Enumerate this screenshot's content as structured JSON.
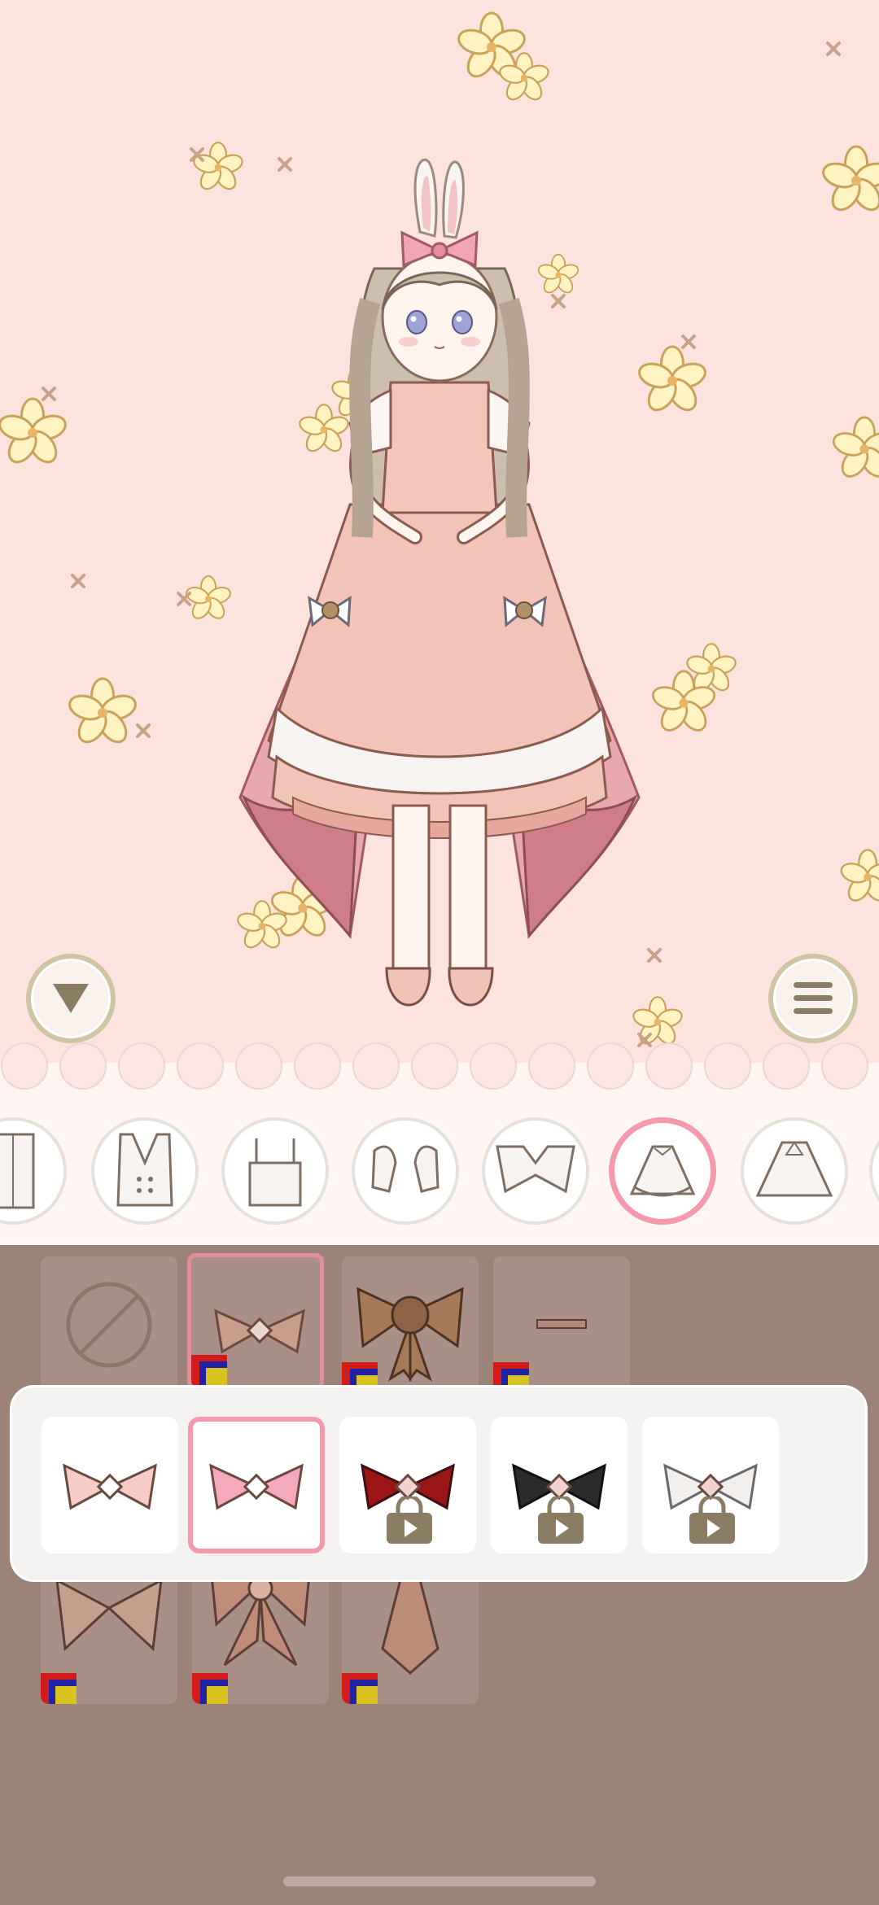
{
  "app": {
    "screen": "dress-up-editor",
    "accent_color": "#f49aac",
    "background_color": "#fde3de",
    "panel_color": "#9c8378"
  },
  "controls": {
    "collapse_icon": "triangle-down-icon",
    "menu_icon": "hamburger-menu-icon"
  },
  "categories": [
    {
      "name": "back-top",
      "icon": "shirt-back-icon",
      "selected": false
    },
    {
      "name": "corset-vest",
      "icon": "vest-icon",
      "selected": false
    },
    {
      "name": "camisole",
      "icon": "camisole-icon",
      "selected": false
    },
    {
      "name": "sleeves",
      "icon": "sleeves-icon",
      "selected": false
    },
    {
      "name": "collar",
      "icon": "collar-icon",
      "selected": false
    },
    {
      "name": "skirt",
      "icon": "skirt-icon",
      "selected": true
    },
    {
      "name": "cape",
      "icon": "cape-icon",
      "selected": false
    },
    {
      "name": "more",
      "icon": "partial-icon",
      "selected": false
    }
  ],
  "items": [
    {
      "icon": "none-icon",
      "selected": false
    },
    {
      "icon": "bow-icon",
      "selected": true
    },
    {
      "icon": "rose-bow-icon",
      "selected": false
    },
    {
      "icon": "choker-icon",
      "selected": false
    },
    {
      "icon": "lace-bow-icon",
      "selected": false
    },
    {
      "icon": "jewel-bow-icon",
      "selected": false
    },
    {
      "icon": "tie-icon",
      "selected": false
    }
  ],
  "color_variants": [
    {
      "color": "#f6cdc6",
      "locked": false,
      "selected": false
    },
    {
      "color": "#f4a9bd",
      "locked": false,
      "selected": true
    },
    {
      "color": "#9b1717",
      "locked": true,
      "selected": false
    },
    {
      "color": "#2b2a2c",
      "locked": true,
      "selected": false
    },
    {
      "color": "#f2eeec",
      "locked": true,
      "selected": false
    }
  ]
}
